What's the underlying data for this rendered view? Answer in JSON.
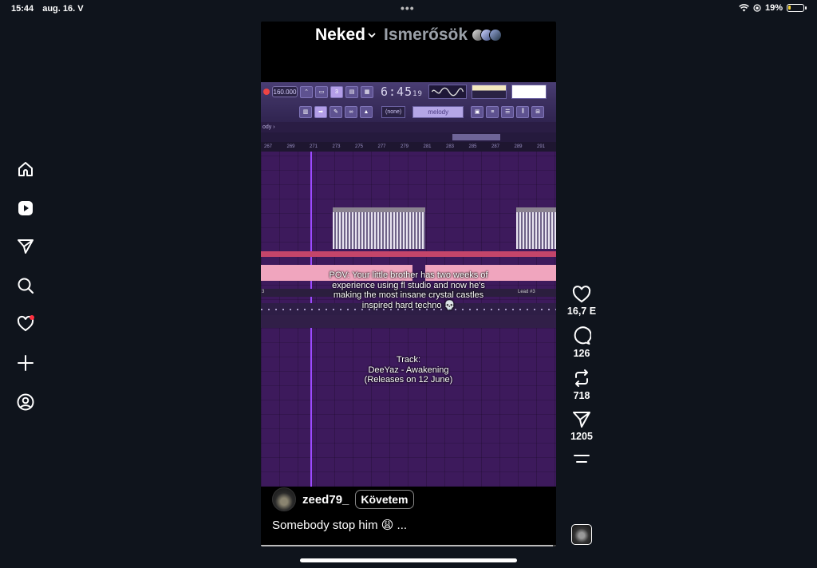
{
  "status": {
    "time": "15:44",
    "date": "aug. 16. V",
    "battery": "19%",
    "battery_level": 0.19,
    "menu_dots": "•••"
  },
  "feed": {
    "tabs": [
      {
        "label": "Neked",
        "active": true
      },
      {
        "label": "Ismerősök",
        "active": false
      }
    ]
  },
  "daw": {
    "tempo": "160.000",
    "time": "6:45",
    "time_frac": "19",
    "pattern_none": "(none)",
    "pattern_name": "melody",
    "path": "ody ›",
    "ruler": [
      "267",
      "269",
      "271",
      "273",
      "275",
      "277",
      "279",
      "281",
      "283",
      "285",
      "287",
      "289",
      "291"
    ],
    "track_label_left": "3",
    "track_label_right": "Lead #3"
  },
  "video": {
    "caption": "POV: Your little brother has two weeks of experience using fl studio and now he's making the most insane crystal castles inspired hard techno 💀",
    "track_line1": "Track:",
    "track_line2": "DeeYaz - Awakening",
    "track_line3": "(Releases on 12 June)",
    "progress": 0.99
  },
  "author": {
    "username": "zeed79_",
    "follow_label": "Követem"
  },
  "post_caption": "Somebody stop him 😩 ...",
  "actions": {
    "likes": "16,7 E",
    "comments": "126",
    "reposts": "718",
    "shares": "1205"
  },
  "colors": {
    "background": "#0f141c",
    "notification": "#ff3040",
    "daw_purple": "#3d1a5c",
    "pink_bar": "#f0a5be",
    "battery_yellow": "#f3d133"
  },
  "sidebar_icons": [
    "home-icon",
    "reels-icon",
    "paper-plane-icon",
    "search-icon",
    "heart-icon",
    "plus-icon",
    "profile-icon"
  ]
}
